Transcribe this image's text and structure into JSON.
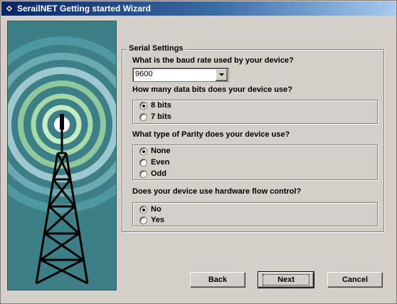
{
  "window": {
    "title": "SerailNET Getting started Wizard"
  },
  "icons": {
    "app": "wizard-app-icon",
    "banner": "radio-tower-image"
  },
  "group": {
    "title": "Serial Settings",
    "baud": {
      "question": "What is the baud rate used by your device?",
      "value": "9600"
    },
    "databits": {
      "question": "How many data bits does your device use?",
      "options": [
        {
          "label": "8 bits",
          "checked": true
        },
        {
          "label": "7 bits",
          "checked": false
        }
      ]
    },
    "parity": {
      "question": "What type of Parity does your device use?",
      "options": [
        {
          "label": "None",
          "checked": true
        },
        {
          "label": "Even",
          "checked": false
        },
        {
          "label": "Odd",
          "checked": false
        }
      ]
    },
    "flow": {
      "question": "Does your device use hardware flow control?",
      "options": [
        {
          "label": "No",
          "checked": true
        },
        {
          "label": "Yes",
          "checked": false
        }
      ]
    }
  },
  "buttons": {
    "back": "Back",
    "next": "Next",
    "cancel": "Cancel"
  },
  "colors": {
    "titlebar_start": "#0a246a",
    "titlebar_end": "#a6caf0",
    "banner_bg": "#3c7f86"
  }
}
